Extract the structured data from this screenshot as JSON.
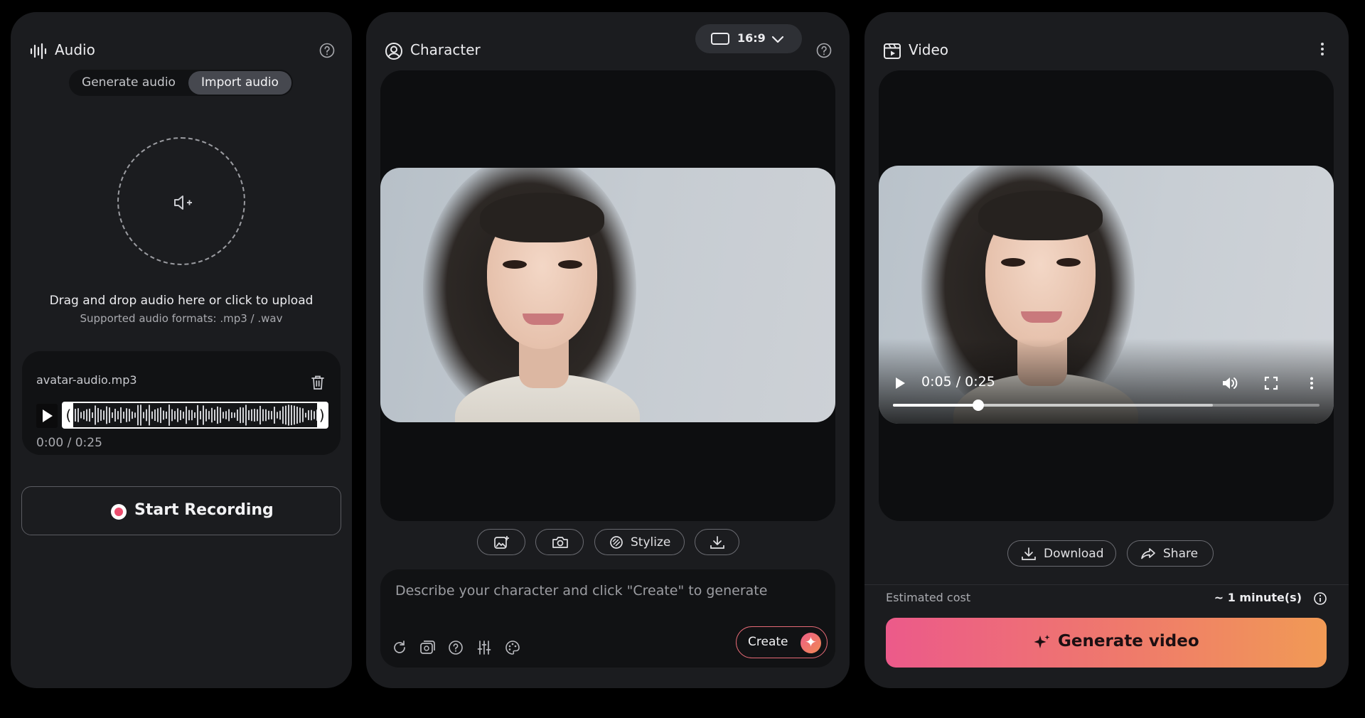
{
  "audio_panel": {
    "title": "Audio",
    "tabs": [
      "Generate audio",
      "Import audio"
    ],
    "selected_tab": "Import audio",
    "upload_text": "Drag and drop audio here or click to upload",
    "upload_formats": "Supported audio formats: .mp3 / .wav",
    "file": {
      "name": "avatar-audio.mp3",
      "time": "0:00 / 0:25"
    },
    "record_label": "Start Recording"
  },
  "character_panel": {
    "title": "Character",
    "aspect_ratio": "16:9",
    "tools": [
      "image-add-icon",
      "camera-icon",
      "Stylize",
      "download-icon"
    ],
    "stylize_label": "Stylize",
    "prompt_placeholder": "Describe your character and click \"Create\" to generate",
    "prompt_icons": [
      "refresh-icon",
      "image-swap-icon",
      "help-icon",
      "sliders-icon",
      "palette-icon"
    ],
    "create_label": "Create"
  },
  "video_panel": {
    "title": "Video",
    "player": {
      "current_time": "0:05 / 0:25",
      "played_fraction": 0.2,
      "buffered_fraction": 0.75
    },
    "download_label": "Download",
    "share_label": "Share",
    "cost_label": "Estimated cost",
    "cost_value": "~ 1 minute(s)",
    "generate_label": "Generate video"
  },
  "colors": {
    "panel": "#1b1c1f",
    "accent_start": "#ec5a8a",
    "accent_end": "#f19a55",
    "record_dot": "#ec4d6e"
  }
}
